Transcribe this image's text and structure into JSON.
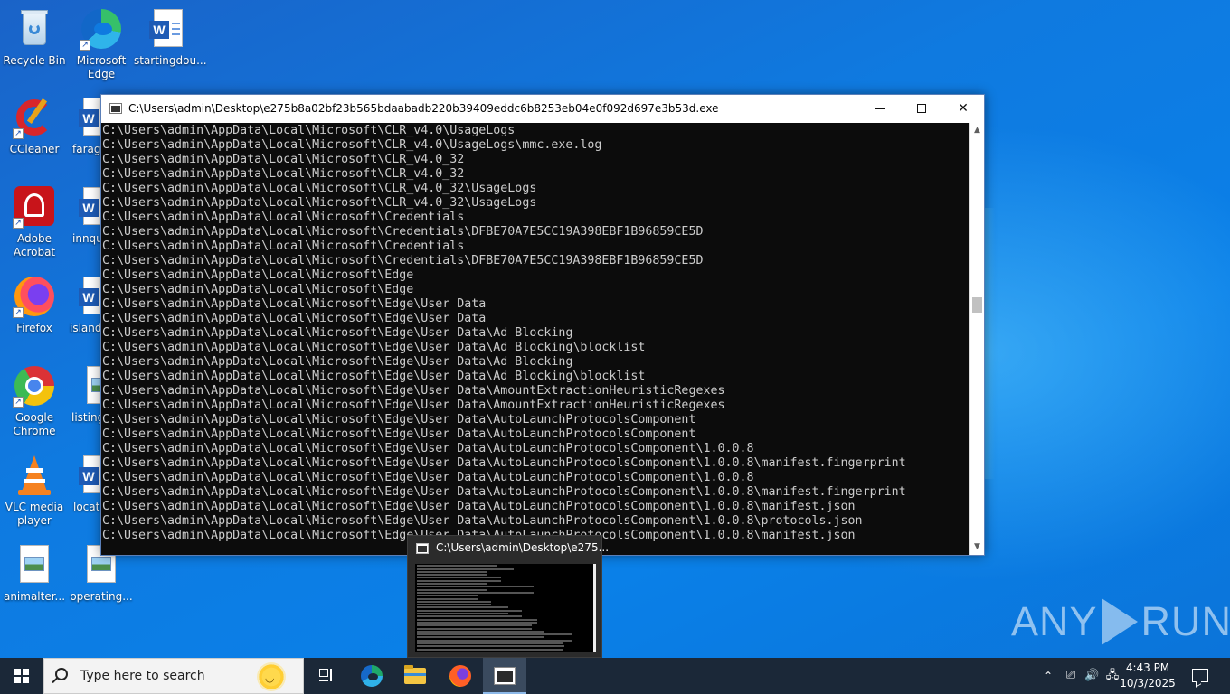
{
  "desktop": {
    "icons": [
      {
        "label": "Recycle Bin"
      },
      {
        "label": "Microsoft Edge"
      },
      {
        "label": "startingdou..."
      },
      {
        "label": "CCleaner"
      },
      {
        "label": "farage"
      },
      {
        "label": "Adobe Acrobat"
      },
      {
        "label": "innqu"
      },
      {
        "label": "Firefox"
      },
      {
        "label": "islandp"
      },
      {
        "label": "Google Chrome"
      },
      {
        "label": "listing"
      },
      {
        "label": "VLC media player"
      },
      {
        "label": "locati"
      },
      {
        "label": "animalter..."
      },
      {
        "label": "operating..."
      }
    ]
  },
  "console": {
    "title": "C:\\Users\\admin\\Desktop\\e275b8a02bf23b565bdaabadb220b39409eddc6b8253eb04e0f092d697e3b53d.exe",
    "lines": [
      "C:\\Users\\admin\\AppData\\Local\\Microsoft\\CLR_v4.0\\UsageLogs",
      "C:\\Users\\admin\\AppData\\Local\\Microsoft\\CLR_v4.0\\UsageLogs\\mmc.exe.log",
      "C:\\Users\\admin\\AppData\\Local\\Microsoft\\CLR_v4.0_32",
      "C:\\Users\\admin\\AppData\\Local\\Microsoft\\CLR_v4.0_32",
      "C:\\Users\\admin\\AppData\\Local\\Microsoft\\CLR_v4.0_32\\UsageLogs",
      "C:\\Users\\admin\\AppData\\Local\\Microsoft\\CLR_v4.0_32\\UsageLogs",
      "C:\\Users\\admin\\AppData\\Local\\Microsoft\\Credentials",
      "C:\\Users\\admin\\AppData\\Local\\Microsoft\\Credentials\\DFBE70A7E5CC19A398EBF1B96859CE5D",
      "C:\\Users\\admin\\AppData\\Local\\Microsoft\\Credentials",
      "C:\\Users\\admin\\AppData\\Local\\Microsoft\\Credentials\\DFBE70A7E5CC19A398EBF1B96859CE5D",
      "C:\\Users\\admin\\AppData\\Local\\Microsoft\\Edge",
      "C:\\Users\\admin\\AppData\\Local\\Microsoft\\Edge",
      "C:\\Users\\admin\\AppData\\Local\\Microsoft\\Edge\\User Data",
      "C:\\Users\\admin\\AppData\\Local\\Microsoft\\Edge\\User Data",
      "C:\\Users\\admin\\AppData\\Local\\Microsoft\\Edge\\User Data\\Ad Blocking",
      "C:\\Users\\admin\\AppData\\Local\\Microsoft\\Edge\\User Data\\Ad Blocking\\blocklist",
      "C:\\Users\\admin\\AppData\\Local\\Microsoft\\Edge\\User Data\\Ad Blocking",
      "C:\\Users\\admin\\AppData\\Local\\Microsoft\\Edge\\User Data\\Ad Blocking\\blocklist",
      "C:\\Users\\admin\\AppData\\Local\\Microsoft\\Edge\\User Data\\AmountExtractionHeuristicRegexes",
      "C:\\Users\\admin\\AppData\\Local\\Microsoft\\Edge\\User Data\\AmountExtractionHeuristicRegexes",
      "C:\\Users\\admin\\AppData\\Local\\Microsoft\\Edge\\User Data\\AutoLaunchProtocolsComponent",
      "C:\\Users\\admin\\AppData\\Local\\Microsoft\\Edge\\User Data\\AutoLaunchProtocolsComponent",
      "C:\\Users\\admin\\AppData\\Local\\Microsoft\\Edge\\User Data\\AutoLaunchProtocolsComponent\\1.0.0.8",
      "C:\\Users\\admin\\AppData\\Local\\Microsoft\\Edge\\User Data\\AutoLaunchProtocolsComponent\\1.0.0.8\\manifest.fingerprint",
      "C:\\Users\\admin\\AppData\\Local\\Microsoft\\Edge\\User Data\\AutoLaunchProtocolsComponent\\1.0.0.8",
      "C:\\Users\\admin\\AppData\\Local\\Microsoft\\Edge\\User Data\\AutoLaunchProtocolsComponent\\1.0.0.8\\manifest.fingerprint",
      "C:\\Users\\admin\\AppData\\Local\\Microsoft\\Edge\\User Data\\AutoLaunchProtocolsComponent\\1.0.0.8\\manifest.json",
      "C:\\Users\\admin\\AppData\\Local\\Microsoft\\Edge\\User Data\\AutoLaunchProtocolsComponent\\1.0.0.8\\protocols.json",
      "C:\\Users\\admin\\AppData\\Local\\Microsoft\\Edge\\User Data\\AutoLaunchProtocolsComponent\\1.0.0.8\\manifest.json"
    ]
  },
  "preview": {
    "title": "C:\\Users\\admin\\Desktop\\e275..."
  },
  "watermark": {
    "left": "ANY",
    "right": "RUN"
  },
  "taskbar": {
    "search_placeholder": "Type here to search",
    "time": "4:43 PM",
    "date": "10/3/2025"
  },
  "colors": {
    "desktop_bg": "#0f7ae0",
    "taskbar_bg": "#1b2838",
    "console_bg": "#0c0c0c",
    "console_text": "#cccccc"
  }
}
